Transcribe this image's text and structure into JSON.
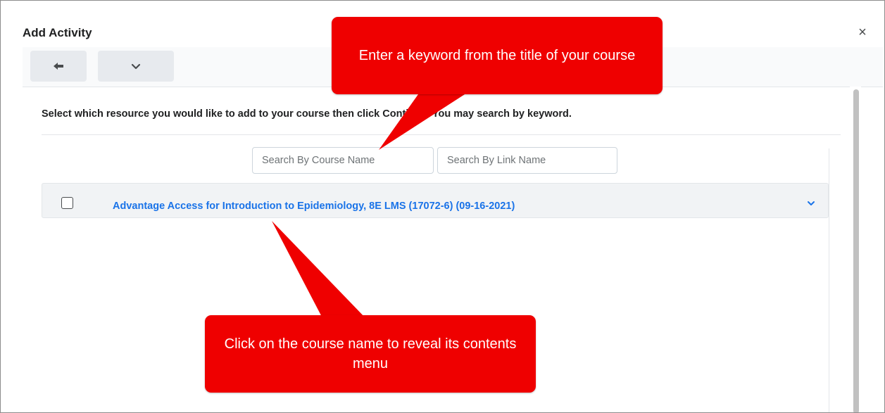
{
  "dialog": {
    "title": "Add Activity",
    "close_glyph": "×"
  },
  "toolbar": {
    "back_icon": "arrow-left-icon",
    "more_icon": "chevron-down-icon"
  },
  "instruction": {
    "before": "Select which resource you would like to add to your course then ",
    "hidden": "click ",
    "strong": "Continue",
    "after": ". You may search by keyword."
  },
  "search": {
    "course_placeholder": "Search By Course Name",
    "link_placeholder": "Search By Link Name"
  },
  "courses": [
    {
      "title": "Advantage Access for Introduction to Epidemiology, 8E LMS (17072-6) (09-16-2021)",
      "checked": false,
      "expand_icon": "chevron-down-icon"
    }
  ],
  "callouts": {
    "top": "Enter a keyword from the title of your course",
    "bottom": "Click on the course name to reveal its contents menu"
  },
  "colors": {
    "accent_link": "#1a73e8",
    "callout": "#ef0000",
    "toolbar_button": "#e7eaee"
  }
}
